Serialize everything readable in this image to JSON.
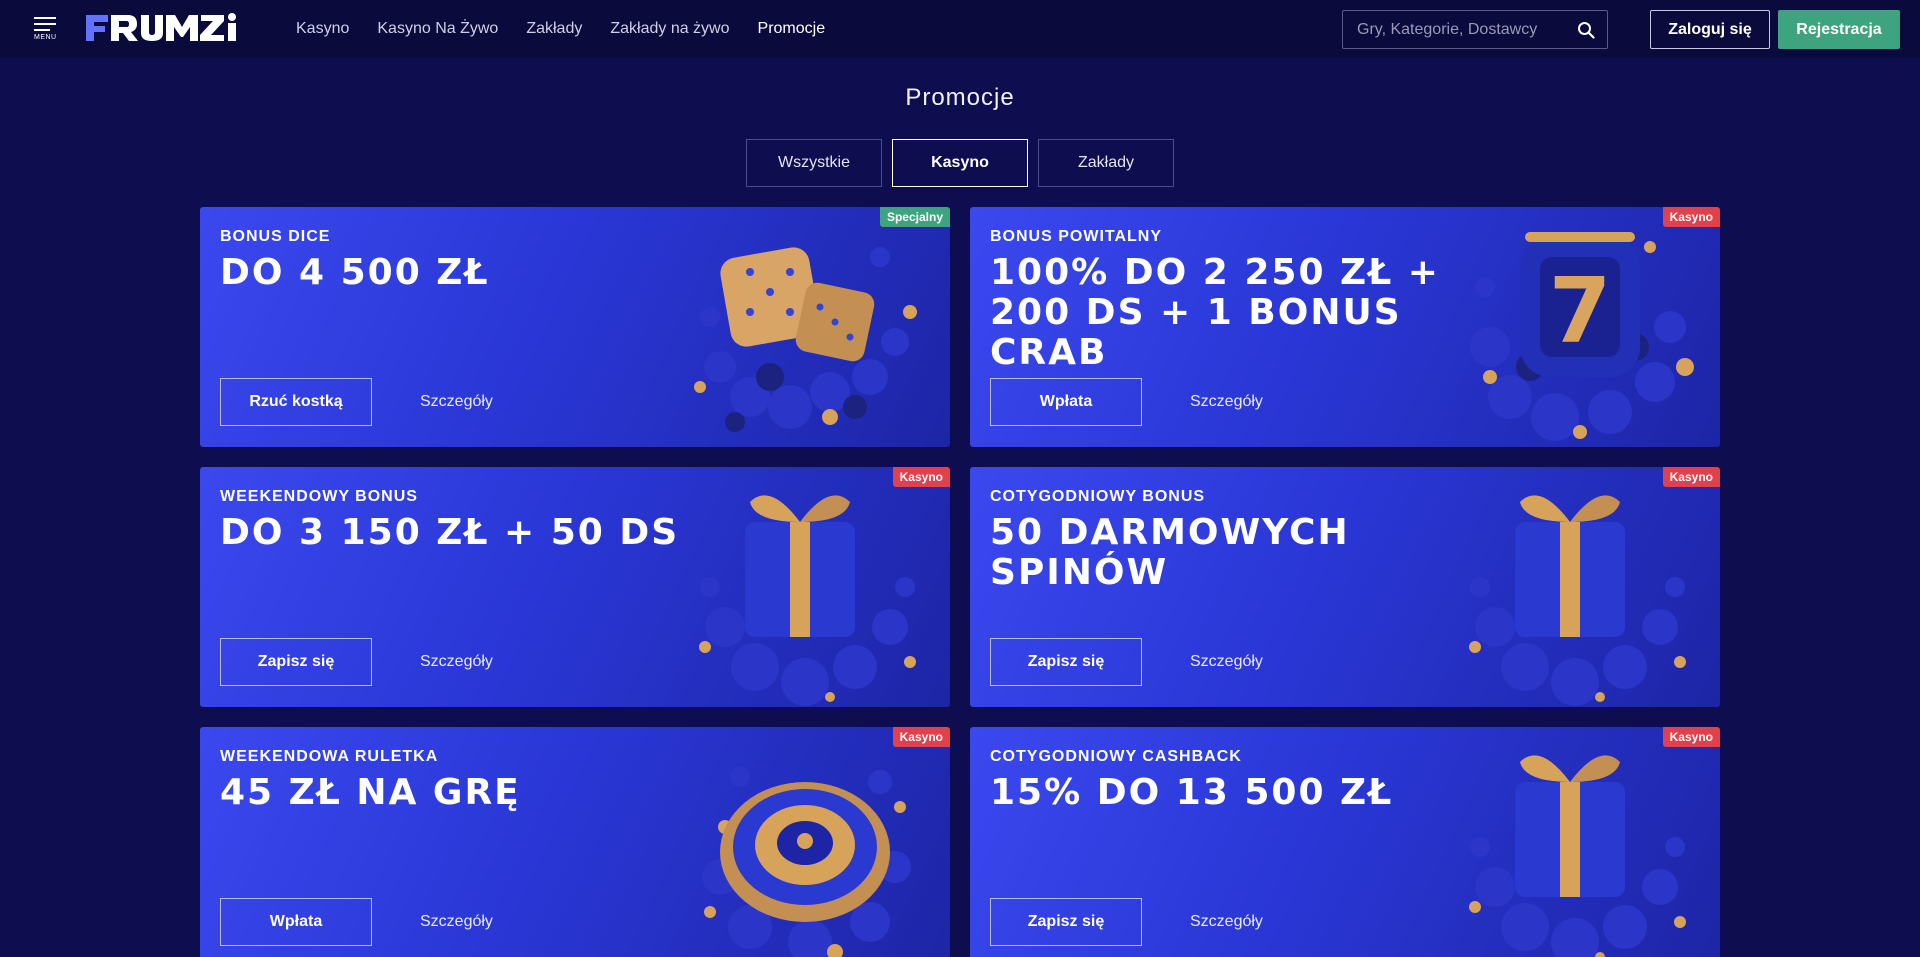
{
  "header": {
    "menu_label": "MENU",
    "logo_text": "FRUMZI",
    "nav": [
      "Kasyno",
      "Kasyno Na Żywo",
      "Zakłady",
      "Zakłady na żywo",
      "Promocje"
    ],
    "search_placeholder": "Gry, Kategorie, Dostawcy",
    "login_label": "Zaloguj się",
    "register_label": "Rejestracja"
  },
  "page": {
    "title": "Promocje",
    "tabs": [
      "Wszystkie",
      "Kasyno",
      "Zakłady"
    ],
    "active_tab": "Kasyno"
  },
  "promos": [
    {
      "kicker": "BONUS DICE",
      "headline": "DO 4 500 ZŁ",
      "cta": "Rzuć kostką",
      "details": "Szczegóły",
      "badge": "Specjalny",
      "badge_color": "#3da47f",
      "art": "dice-icon"
    },
    {
      "kicker": "BONUS POWITALNY",
      "headline": "100% DO 2 250 ZŁ + 200 DS + 1 BONUS CRAB",
      "cta": "Wpłata",
      "details": "Szczegóły",
      "badge": "Kasyno",
      "badge_color": "#e0414a",
      "art": "slot-seven-icon"
    },
    {
      "kicker": "WEEKENDOWY BONUS",
      "headline": "DO 3 150 ZŁ + 50 DS",
      "cta": "Zapisz się",
      "details": "Szczegóły",
      "badge": "Kasyno",
      "badge_color": "#e0414a",
      "art": "gift-icon"
    },
    {
      "kicker": "COTYGODNIOWY BONUS",
      "headline": "50 DARMOWYCH SPINÓW",
      "cta": "Zapisz się",
      "details": "Szczegóły",
      "badge": "Kasyno",
      "badge_color": "#e0414a",
      "art": "gift-icon"
    },
    {
      "kicker": "WEEKENDOWA RULETKA",
      "headline": "45 ZŁ NA GRĘ",
      "cta": "Wpłata",
      "details": "Szczegóły",
      "badge": "Kasyno",
      "badge_color": "#e0414a",
      "art": "roulette-icon"
    },
    {
      "kicker": "COTYGODNIOWY CASHBACK",
      "headline": "15% DO 13 500 ZŁ",
      "cta": "Zapisz się",
      "details": "Szczegóły",
      "badge": "Kasyno",
      "badge_color": "#e0414a",
      "art": "gift-icon"
    }
  ],
  "colors": {
    "background": "#0d0d4f",
    "header": "#0a0a3c",
    "accent_green": "#3da47f",
    "badge_red": "#e0414a",
    "card_blue": "#3a48ee"
  }
}
